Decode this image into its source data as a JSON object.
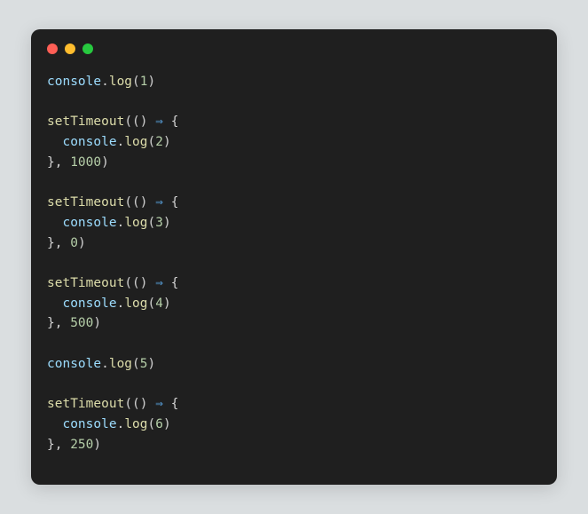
{
  "window": {
    "controls": [
      "close",
      "minimize",
      "maximize"
    ]
  },
  "code": {
    "lines": [
      [
        {
          "t": "console",
          "c": "tk-obj"
        },
        {
          "t": ".",
          "c": "tk-op"
        },
        {
          "t": "log",
          "c": "tk-func"
        },
        {
          "t": "(",
          "c": "tk-paren"
        },
        {
          "t": "1",
          "c": "tk-num"
        },
        {
          "t": ")",
          "c": "tk-paren"
        }
      ],
      [],
      [
        {
          "t": "setTimeout",
          "c": "tk-func"
        },
        {
          "t": "((",
          "c": "tk-paren"
        },
        {
          "t": ") ",
          "c": "tk-paren"
        },
        {
          "t": "⇒",
          "c": "tk-arrow"
        },
        {
          "t": " {",
          "c": "tk-brace"
        }
      ],
      [
        {
          "t": "  ",
          "c": "tk-op"
        },
        {
          "t": "console",
          "c": "tk-obj"
        },
        {
          "t": ".",
          "c": "tk-op"
        },
        {
          "t": "log",
          "c": "tk-func"
        },
        {
          "t": "(",
          "c": "tk-paren"
        },
        {
          "t": "2",
          "c": "tk-num"
        },
        {
          "t": ")",
          "c": "tk-paren"
        }
      ],
      [
        {
          "t": "}, ",
          "c": "tk-brace"
        },
        {
          "t": "1000",
          "c": "tk-num"
        },
        {
          "t": ")",
          "c": "tk-paren"
        }
      ],
      [],
      [
        {
          "t": "setTimeout",
          "c": "tk-func"
        },
        {
          "t": "((",
          "c": "tk-paren"
        },
        {
          "t": ") ",
          "c": "tk-paren"
        },
        {
          "t": "⇒",
          "c": "tk-arrow"
        },
        {
          "t": " {",
          "c": "tk-brace"
        }
      ],
      [
        {
          "t": "  ",
          "c": "tk-op"
        },
        {
          "t": "console",
          "c": "tk-obj"
        },
        {
          "t": ".",
          "c": "tk-op"
        },
        {
          "t": "log",
          "c": "tk-func"
        },
        {
          "t": "(",
          "c": "tk-paren"
        },
        {
          "t": "3",
          "c": "tk-num"
        },
        {
          "t": ")",
          "c": "tk-paren"
        }
      ],
      [
        {
          "t": "}, ",
          "c": "tk-brace"
        },
        {
          "t": "0",
          "c": "tk-num"
        },
        {
          "t": ")",
          "c": "tk-paren"
        }
      ],
      [],
      [
        {
          "t": "setTimeout",
          "c": "tk-func"
        },
        {
          "t": "((",
          "c": "tk-paren"
        },
        {
          "t": ") ",
          "c": "tk-paren"
        },
        {
          "t": "⇒",
          "c": "tk-arrow"
        },
        {
          "t": " {",
          "c": "tk-brace"
        }
      ],
      [
        {
          "t": "  ",
          "c": "tk-op"
        },
        {
          "t": "console",
          "c": "tk-obj"
        },
        {
          "t": ".",
          "c": "tk-op"
        },
        {
          "t": "log",
          "c": "tk-func"
        },
        {
          "t": "(",
          "c": "tk-paren"
        },
        {
          "t": "4",
          "c": "tk-num"
        },
        {
          "t": ")",
          "c": "tk-paren"
        }
      ],
      [
        {
          "t": "}, ",
          "c": "tk-brace"
        },
        {
          "t": "500",
          "c": "tk-num"
        },
        {
          "t": ")",
          "c": "tk-paren"
        }
      ],
      [],
      [
        {
          "t": "console",
          "c": "tk-obj"
        },
        {
          "t": ".",
          "c": "tk-op"
        },
        {
          "t": "log",
          "c": "tk-func"
        },
        {
          "t": "(",
          "c": "tk-paren"
        },
        {
          "t": "5",
          "c": "tk-num"
        },
        {
          "t": ")",
          "c": "tk-paren"
        }
      ],
      [],
      [
        {
          "t": "setTimeout",
          "c": "tk-func"
        },
        {
          "t": "((",
          "c": "tk-paren"
        },
        {
          "t": ") ",
          "c": "tk-paren"
        },
        {
          "t": "⇒",
          "c": "tk-arrow"
        },
        {
          "t": " {",
          "c": "tk-brace"
        }
      ],
      [
        {
          "t": "  ",
          "c": "tk-op"
        },
        {
          "t": "console",
          "c": "tk-obj"
        },
        {
          "t": ".",
          "c": "tk-op"
        },
        {
          "t": "log",
          "c": "tk-func"
        },
        {
          "t": "(",
          "c": "tk-paren"
        },
        {
          "t": "6",
          "c": "tk-num"
        },
        {
          "t": ")",
          "c": "tk-paren"
        }
      ],
      [
        {
          "t": "}, ",
          "c": "tk-brace"
        },
        {
          "t": "250",
          "c": "tk-num"
        },
        {
          "t": ")",
          "c": "tk-paren"
        }
      ]
    ]
  }
}
